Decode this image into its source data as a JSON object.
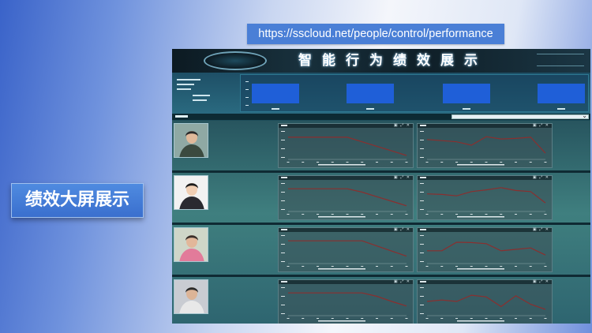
{
  "url": "https://sscloud.net/people/control/performance",
  "side_label": "绩效大屏展示",
  "banner": {
    "title": "智能行为绩效展示"
  },
  "top_bar_chart": {
    "type": "bar",
    "values": [
      0.7,
      0.7,
      0.7,
      0.7
    ]
  },
  "select": {
    "arrow": "⌄"
  },
  "chart_icons": "▣ ⤢ ✕",
  "rows": [
    {
      "photo": {
        "bg": "#8fa9a4",
        "shirt": "#3b4a3f",
        "skin": "#e0b99a",
        "hair": "#2a2a2a"
      },
      "left_series": [
        0.78,
        0.78,
        0.78,
        0.78,
        0.78,
        0.62,
        0.46,
        0.3,
        0.14
      ],
      "right_series": [
        0.7,
        0.66,
        0.62,
        0.5,
        0.8,
        0.72,
        0.74,
        0.78,
        0.22
      ]
    },
    {
      "photo": {
        "bg": "#f2f2f2",
        "shirt": "#2a2a30",
        "skin": "#f1cfb4",
        "hair": "#1c1c1c"
      },
      "left_series": [
        0.8,
        0.8,
        0.8,
        0.8,
        0.8,
        0.68,
        0.52,
        0.36,
        0.2
      ],
      "right_series": [
        0.62,
        0.6,
        0.55,
        0.7,
        0.76,
        0.84,
        0.74,
        0.7,
        0.3
      ]
    },
    {
      "photo": {
        "bg": "#cfd6c8",
        "shirt": "#e27b9a",
        "skin": "#e2b79a",
        "hair": "#3a2f2a"
      },
      "left_series": [
        0.8,
        0.8,
        0.8,
        0.8,
        0.8,
        0.8,
        0.62,
        0.44,
        0.26
      ],
      "right_series": [
        0.45,
        0.45,
        0.75,
        0.74,
        0.7,
        0.45,
        0.5,
        0.55,
        0.3
      ]
    },
    {
      "photo": {
        "bg": "#c9ccd2",
        "shirt": "#e8e8e8",
        "skin": "#dcb497",
        "hair": "#2a2a2a"
      },
      "left_series": [
        0.8,
        0.8,
        0.8,
        0.8,
        0.8,
        0.8,
        0.68,
        0.5,
        0.34
      ],
      "right_series": [
        0.5,
        0.55,
        0.5,
        0.72,
        0.66,
        0.32,
        0.7,
        0.4,
        0.22
      ]
    }
  ],
  "colors": {
    "url_box": "#4a7fd6",
    "series_line": "#8a2f2f",
    "bar_fill": "#1f5fd8"
  }
}
